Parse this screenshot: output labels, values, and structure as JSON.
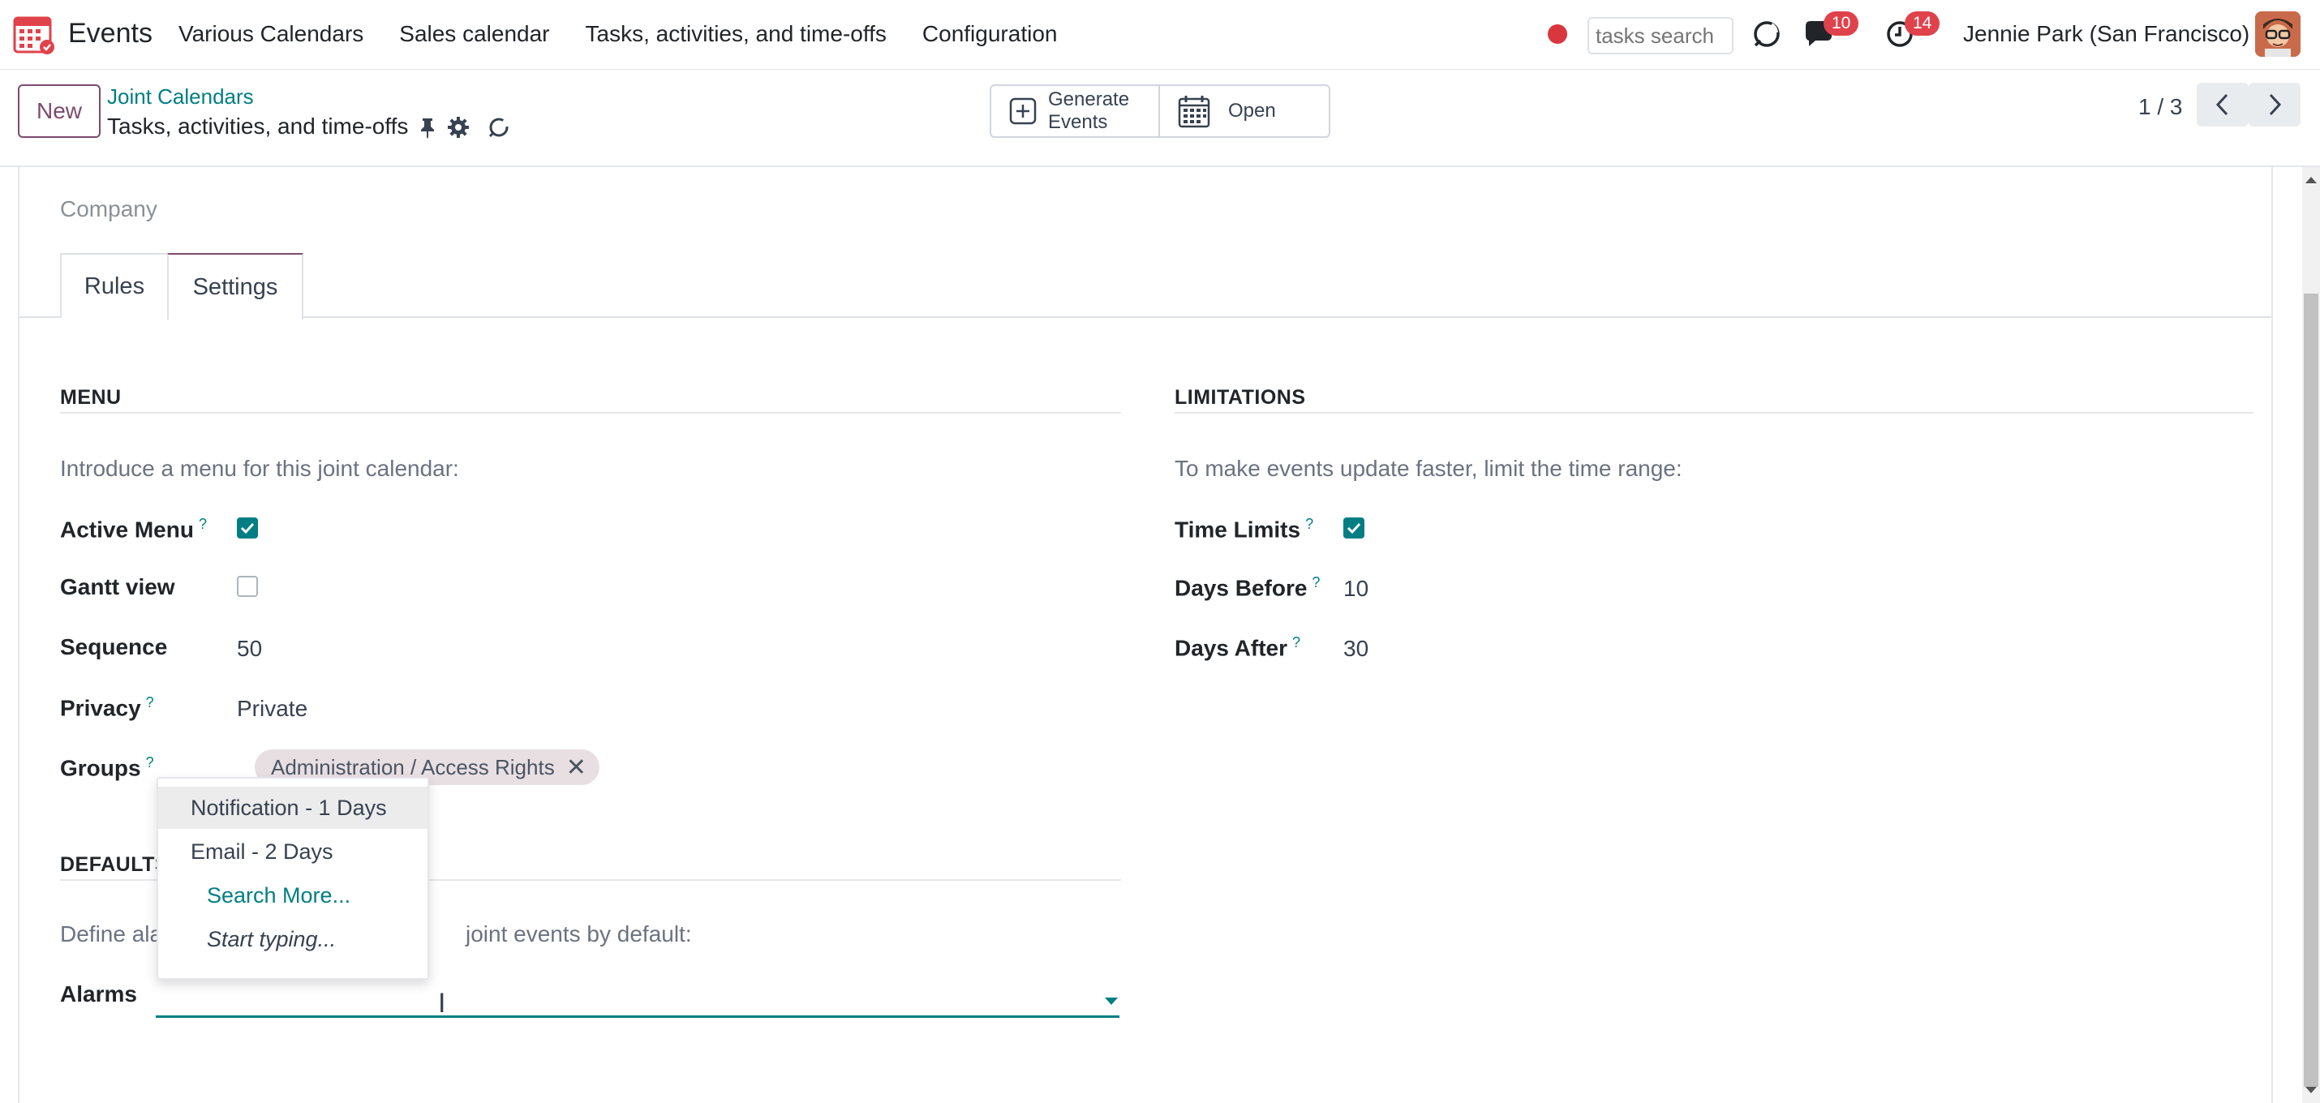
{
  "navbar": {
    "app_name": "Events",
    "menu": [
      "Various Calendars",
      "Sales calendar",
      "Tasks, activities, and time-offs",
      "Configuration"
    ],
    "search_placeholder": "tasks search",
    "messages_count": "10",
    "activities_count": "14",
    "user": "Jennie Park (San Francisco)"
  },
  "control": {
    "new_label": "New",
    "breadcrumb_parent": "Joint Calendars",
    "breadcrumb_current": "Tasks, activities, and time-offs",
    "generate_label_1": "Generate",
    "generate_label_2": "Events",
    "open_label": "Open",
    "pager": "1 / 3"
  },
  "form": {
    "company_placeholder": "Company",
    "tabs": [
      "Rules",
      "Settings"
    ],
    "active_tab": "Settings",
    "menu_section": {
      "title": "MENU",
      "intro": "Introduce a menu for this joint calendar:",
      "active_menu_label": "Active Menu",
      "active_menu": true,
      "gantt_label": "Gantt view",
      "gantt": false,
      "sequence_label": "Sequence",
      "sequence": "50",
      "privacy_label": "Privacy",
      "privacy": "Private",
      "groups_label": "Groups",
      "groups_tag": "Administration / Access Rights"
    },
    "limitations": {
      "title": "LIMITATIONS",
      "intro": "To make events update faster, limit the time range:",
      "time_limits_label": "Time Limits",
      "time_limits": true,
      "days_before_label": "Days Before",
      "days_before": "10",
      "days_after_label": "Days After",
      "days_after": "30"
    },
    "defaults": {
      "title": "DEFAULTS",
      "intro_left": "Define ala",
      "intro_right": "joint events by default:",
      "alarms_label": "Alarms"
    },
    "help_mark": "?"
  },
  "dropdown": {
    "items": [
      "Notification - 1 Days",
      "Email - 2 Days"
    ],
    "search_more": "Search More...",
    "hint": "Start typing..."
  },
  "colors": {
    "accent": "#017e84",
    "brand": "#7c4a6e",
    "badge": "#e0424b"
  }
}
